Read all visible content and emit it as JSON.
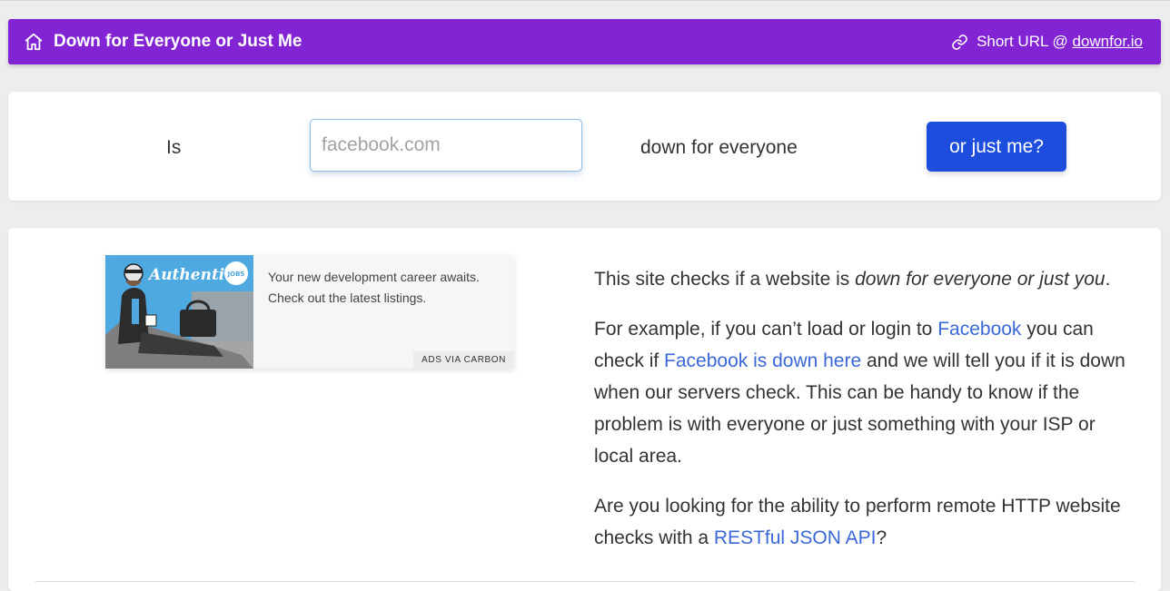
{
  "navbar": {
    "title": "Down for Everyone or Just Me",
    "short_url_label": "Short URL @ ",
    "short_url_link": "downfor.io",
    "bg_color": "#8224d4",
    "home_icon": "home-icon",
    "link_icon": "link-icon"
  },
  "search": {
    "is_label": "Is",
    "placeholder": "facebook.com",
    "value": "",
    "down_label": "down for everyone",
    "button_label": "or just me?",
    "button_color": "#1c4ddc"
  },
  "ad": {
    "image_text": "Authentic",
    "image_badge": "JOBS",
    "text": "Your new development career awaits. Check out the latest listings.",
    "badge": "ADS VIA CARBON"
  },
  "info": {
    "p1_prefix": "This site checks if a website is ",
    "p1_em": "down for everyone or just you",
    "p1_suffix": ".",
    "p2_part1": "For example, if you can’t load or login to ",
    "p2_link1": "Facebook",
    "p2_part2": " you can check if ",
    "p2_link2": "Facebook is down here",
    "p2_part3": " and we will tell you if it is down when our servers check. This can be handy to know if the problem is with everyone or just something with your ISP or local area.",
    "p3_part1": "Are you looking for the ability to perform remote HTTP website checks with a ",
    "p3_link": "RESTful JSON API",
    "p3_part2": "?",
    "link_color": "#3a68d8"
  }
}
